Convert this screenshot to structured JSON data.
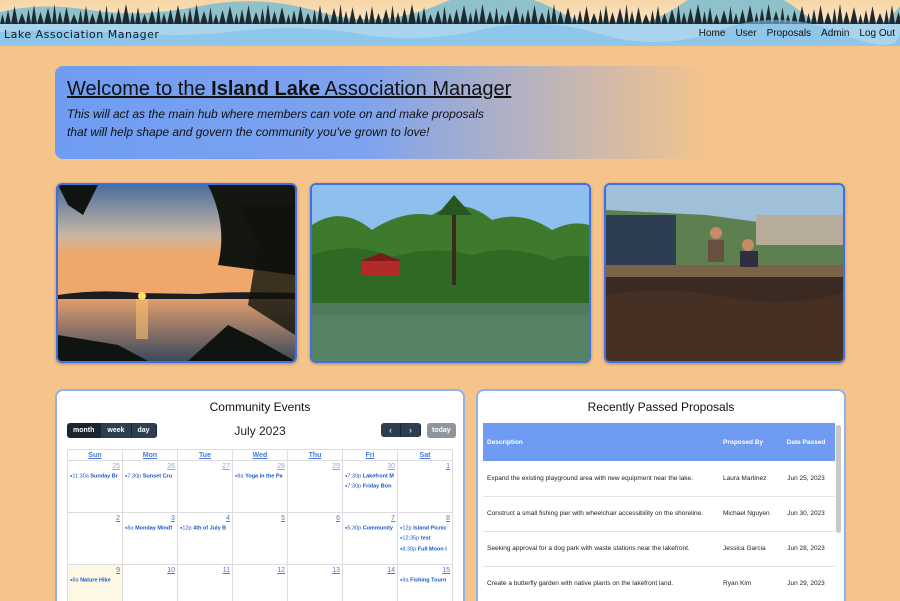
{
  "header": {
    "brand": "Lake Association Manager",
    "nav": [
      "Home",
      "User",
      "Proposals",
      "Admin",
      "Log Out"
    ]
  },
  "welcome": {
    "title_prefix": "Welcome to the ",
    "title_bold": "Island Lake",
    "title_suffix": " Association Manager",
    "text_line1": "This will act as the main hub where members can vote on and make proposals",
    "text_line2": "that will help shape and govern the community you've grown to love!"
  },
  "photos": [
    "sunset-lake-photo",
    "island-cabin-photo",
    "dock-people-photo"
  ],
  "calendar": {
    "title": "Community Events",
    "views": [
      "month",
      "week",
      "day"
    ],
    "month_label": "July 2023",
    "prev": "‹",
    "next": "›",
    "today": "today",
    "weekdays": [
      "Sun",
      "Mon",
      "Tue",
      "Wed",
      "Thu",
      "Fri",
      "Sat"
    ],
    "weeks": [
      [
        {
          "day": "25",
          "other": true,
          "events": [
            {
              "time": "11:30a",
              "title": "Sunday Br"
            }
          ]
        },
        {
          "day": "26",
          "other": true,
          "events": [
            {
              "time": "7:30p",
              "title": "Sunset Cru"
            }
          ]
        },
        {
          "day": "27",
          "other": true,
          "events": []
        },
        {
          "day": "28",
          "other": true,
          "events": [
            {
              "time": "8a",
              "title": "Yoga in the Pa"
            }
          ]
        },
        {
          "day": "29",
          "other": true,
          "events": []
        },
        {
          "day": "30",
          "other": true,
          "events": [
            {
              "time": "7:30p",
              "title": "Lakefront M"
            },
            {
              "time": "7:30p",
              "title": "Friday Bon"
            }
          ]
        },
        {
          "day": "1",
          "other": false,
          "events": []
        }
      ],
      [
        {
          "day": "2",
          "other": false,
          "events": []
        },
        {
          "day": "3",
          "other": false,
          "events": [
            {
              "time": "8a",
              "title": "Monday Mindf"
            }
          ]
        },
        {
          "day": "4",
          "other": false,
          "events": [
            {
              "time": "12p",
              "title": "4th of July B"
            }
          ]
        },
        {
          "day": "5",
          "other": false,
          "events": []
        },
        {
          "day": "6",
          "other": false,
          "events": []
        },
        {
          "day": "7",
          "other": false,
          "events": [
            {
              "time": "5:30p",
              "title": "Community"
            }
          ]
        },
        {
          "day": "8",
          "other": false,
          "events": [
            {
              "time": "12p",
              "title": "Island Picnic"
            },
            {
              "time": "12:35p",
              "title": "test"
            },
            {
              "time": "8:30p",
              "title": "Full Moon I"
            }
          ]
        }
      ],
      [
        {
          "day": "9",
          "other": false,
          "today": true,
          "events": [
            {
              "time": "8a",
              "title": "Nature Hike"
            }
          ]
        },
        {
          "day": "10",
          "other": false,
          "events": []
        },
        {
          "day": "11",
          "other": false,
          "events": []
        },
        {
          "day": "12",
          "other": false,
          "events": []
        },
        {
          "day": "13",
          "other": false,
          "events": []
        },
        {
          "day": "14",
          "other": false,
          "events": []
        },
        {
          "day": "15",
          "other": false,
          "events": [
            {
              "time": "9a",
              "title": "Fishing Tourn"
            }
          ]
        }
      ]
    ]
  },
  "proposals": {
    "title": "Recently Passed Proposals",
    "headers": [
      "Description",
      "Proposed By",
      "Date Passed"
    ],
    "rows": [
      {
        "description": "Expand the existing playground area with new equipment near the lake.",
        "by": "Laura Martinez",
        "date": "Jun 25, 2023"
      },
      {
        "description": "Construct a small fishing pier with wheelchair accessibility on the shoreline.",
        "by": "Michael Nguyen",
        "date": "Jun 30, 2023"
      },
      {
        "description": "Seeking approval for a dog park with waste stations near the lakefront.",
        "by": "Jessica Garcia",
        "date": "Jun 28, 2023"
      },
      {
        "description": "Create a butterfly garden with native plants on the lakefront land.",
        "by": "Ryan Kim",
        "date": "Jun 29, 2023"
      }
    ]
  }
}
